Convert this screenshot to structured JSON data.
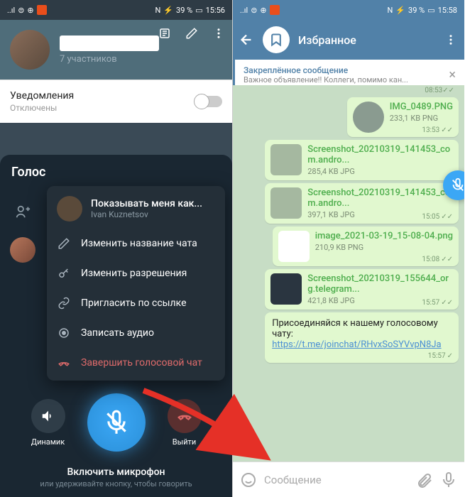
{
  "status": {
    "battery": "39 %",
    "time_l": "15:56",
    "time_r": "15:58",
    "nfc": "N"
  },
  "left": {
    "group_sub": "7 участников",
    "notif_label": "Уведомления",
    "notif_state": "Отключены",
    "vc_title": "Голос",
    "menu": {
      "head_title": "Показывать меня как...",
      "head_sub": "Ivan Kuznetsov",
      "items": [
        {
          "icon": "✎",
          "label": "Изменить название чата"
        },
        {
          "icon": "🔑",
          "label": "Изменить разрешения"
        },
        {
          "icon": "🔗",
          "label": "Пригласить по ссылке"
        },
        {
          "icon": "●",
          "label": "Записать аудио"
        }
      ],
      "end": "Завершить голосовой чат"
    },
    "controls": {
      "speaker": "Динамик",
      "leave": "Выйти"
    },
    "hint_main": "Включить микрофон",
    "hint_sub": "или удерживайте кнопку, чтобы говорить"
  },
  "right": {
    "title": "Избранное",
    "pinned_title": "Закреплённое сообщение",
    "pinned_text": "Важное объявление!! Коллеги, помимо кан...",
    "files": [
      {
        "name": "",
        "size": "",
        "time": "08:53"
      },
      {
        "name": "IMG_0489.PNG",
        "size": "233,1 KB PNG",
        "time": "13:53"
      },
      {
        "name": "Screenshot_20210319_141453_com.andro...",
        "size": "285,4 KB JPG",
        "time": ""
      },
      {
        "name": "Screenshot_20210319_141453_com.andro...",
        "size": "397,1 KB JPG",
        "time": "15:05"
      },
      {
        "name": "image_2021-03-19_15-08-04.png",
        "size": "210,9 KB PNG",
        "time": "15:08"
      },
      {
        "name": "Screenshot_20210319_155644_org.telegram...",
        "size": "421,8 KB JPG",
        "time": "15:57"
      }
    ],
    "text_msg": "Присоединяйся к нашему голосовому чату: ",
    "text_link": "https://t.me/joinchat/RHvxSoSYVvpN8Ja",
    "text_time": "15:57",
    "input_placeholder": "Сообщение"
  }
}
